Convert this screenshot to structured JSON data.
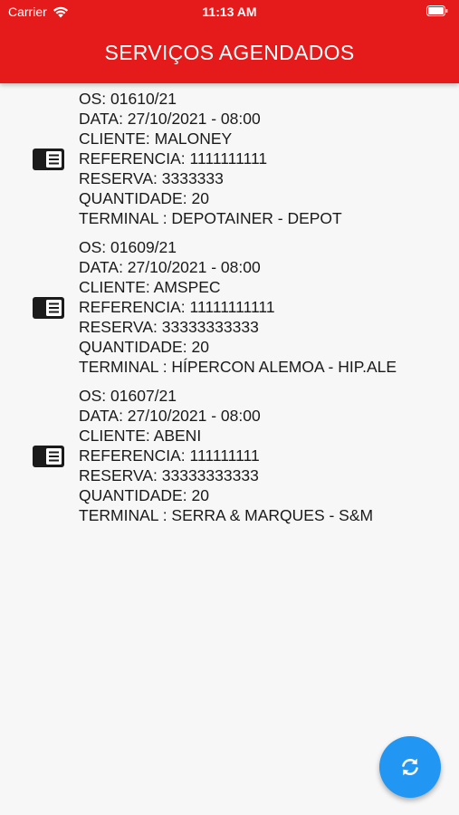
{
  "status_bar": {
    "carrier": "Carrier",
    "time": "11:13 AM"
  },
  "header": {
    "title": "SERVIÇOS AGENDADOS",
    "color": "#e51b1b"
  },
  "services": [
    {
      "os": "OS: 01610/21",
      "data": "DATA: 27/10/2021 - 08:00",
      "cliente": "CLIENTE: MALONEY",
      "referencia": "REFERENCIA: 1111111111",
      "reserva": "RESERVA: 3333333",
      "quantidade": "QUANTIDADE: 20",
      "terminal": "TERMINAL : DEPOTAINER - DEPOT"
    },
    {
      "os": "OS: 01609/21",
      "data": "DATA: 27/10/2021 - 08:00",
      "cliente": "CLIENTE: AMSPEC",
      "referencia": "REFERENCIA: 11111111111",
      "reserva": "RESERVA: 33333333333",
      "quantidade": "QUANTIDADE: 20",
      "terminal": "TERMINAL : HÍPERCON ALEMOA - HIP.ALE"
    },
    {
      "os": "OS: 01607/21",
      "data": "DATA: 27/10/2021 - 08:00",
      "cliente": "CLIENTE: ABENI",
      "referencia": "REFERENCIA: 111111111",
      "reserva": "RESERVA: 33333333333",
      "quantidade": "QUANTIDADE: 20",
      "terminal": "TERMINAL : SERRA & MARQUES - S&M"
    }
  ],
  "refresh_button": {
    "icon": "refresh-icon",
    "color": "#2196f3"
  }
}
